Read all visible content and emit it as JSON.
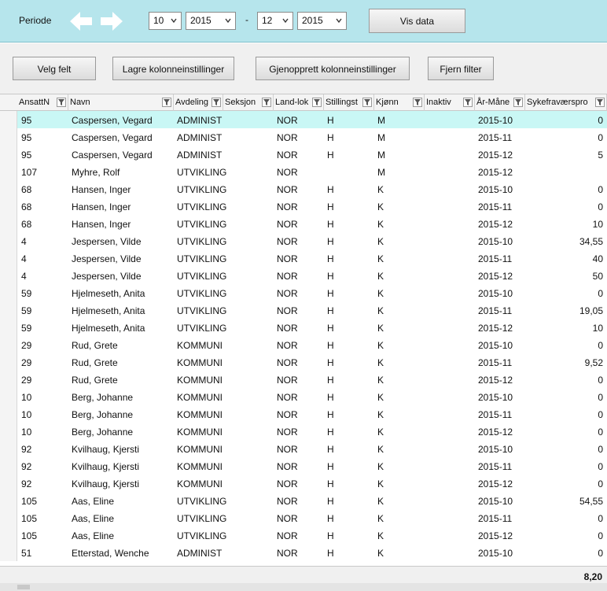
{
  "period": {
    "label": "Periode",
    "from_month": "10",
    "from_year": "2015",
    "separator": "-",
    "to_month": "12",
    "to_year": "2015",
    "show_button": "Vis data"
  },
  "toolbar": {
    "select_fields": "Velg felt",
    "save_columns": "Lagre kolonneinstillinger",
    "restore_columns": "Gjenopprett kolonneinstillinger",
    "remove_filter": "Fjern filter"
  },
  "columns": [
    {
      "label": "AnsattN"
    },
    {
      "label": "Navn"
    },
    {
      "label": "Avdeling"
    },
    {
      "label": "Seksjon"
    },
    {
      "label": "Land-lok"
    },
    {
      "label": "Stillingst"
    },
    {
      "label": "Kjønn"
    },
    {
      "label": "Inaktiv"
    },
    {
      "label": "År-Måne"
    },
    {
      "label": "Sykefraværspro"
    }
  ],
  "rows": [
    {
      "id": "95",
      "name": "Caspersen, Vegard",
      "dept": "ADMINIST",
      "country": "NOR",
      "pos": "H",
      "gender": "M",
      "period": "2015-10",
      "pct": "0"
    },
    {
      "id": "95",
      "name": "Caspersen, Vegard",
      "dept": "ADMINIST",
      "country": "NOR",
      "pos": "H",
      "gender": "M",
      "period": "2015-11",
      "pct": "0"
    },
    {
      "id": "95",
      "name": "Caspersen, Vegard",
      "dept": "ADMINIST",
      "country": "NOR",
      "pos": "H",
      "gender": "M",
      "period": "2015-12",
      "pct": "5"
    },
    {
      "id": "107",
      "name": "Myhre, Rolf",
      "dept": "UTVIKLING",
      "country": "NOR",
      "pos": "",
      "gender": "M",
      "period": "2015-12",
      "pct": ""
    },
    {
      "id": "68",
      "name": "Hansen, Inger",
      "dept": "UTVIKLING",
      "country": "NOR",
      "pos": "H",
      "gender": "K",
      "period": "2015-10",
      "pct": "0"
    },
    {
      "id": "68",
      "name": "Hansen, Inger",
      "dept": "UTVIKLING",
      "country": "NOR",
      "pos": "H",
      "gender": "K",
      "period": "2015-11",
      "pct": "0"
    },
    {
      "id": "68",
      "name": "Hansen, Inger",
      "dept": "UTVIKLING",
      "country": "NOR",
      "pos": "H",
      "gender": "K",
      "period": "2015-12",
      "pct": "10"
    },
    {
      "id": "4",
      "name": "Jespersen, Vilde",
      "dept": "UTVIKLING",
      "country": "NOR",
      "pos": "H",
      "gender": "K",
      "period": "2015-10",
      "pct": "34,55"
    },
    {
      "id": "4",
      "name": "Jespersen, Vilde",
      "dept": "UTVIKLING",
      "country": "NOR",
      "pos": "H",
      "gender": "K",
      "period": "2015-11",
      "pct": "40"
    },
    {
      "id": "4",
      "name": "Jespersen, Vilde",
      "dept": "UTVIKLING",
      "country": "NOR",
      "pos": "H",
      "gender": "K",
      "period": "2015-12",
      "pct": "50"
    },
    {
      "id": "59",
      "name": "Hjelmeseth, Anita",
      "dept": "UTVIKLING",
      "country": "NOR",
      "pos": "H",
      "gender": "K",
      "period": "2015-10",
      "pct": "0"
    },
    {
      "id": "59",
      "name": "Hjelmeseth, Anita",
      "dept": "UTVIKLING",
      "country": "NOR",
      "pos": "H",
      "gender": "K",
      "period": "2015-11",
      "pct": "19,05"
    },
    {
      "id": "59",
      "name": "Hjelmeseth, Anita",
      "dept": "UTVIKLING",
      "country": "NOR",
      "pos": "H",
      "gender": "K",
      "period": "2015-12",
      "pct": "10"
    },
    {
      "id": "29",
      "name": "Rud, Grete",
      "dept": "KOMMUNI",
      "country": "NOR",
      "pos": "H",
      "gender": "K",
      "period": "2015-10",
      "pct": "0"
    },
    {
      "id": "29",
      "name": "Rud, Grete",
      "dept": "KOMMUNI",
      "country": "NOR",
      "pos": "H",
      "gender": "K",
      "period": "2015-11",
      "pct": "9,52"
    },
    {
      "id": "29",
      "name": "Rud, Grete",
      "dept": "KOMMUNI",
      "country": "NOR",
      "pos": "H",
      "gender": "K",
      "period": "2015-12",
      "pct": "0"
    },
    {
      "id": "10",
      "name": "Berg, Johanne",
      "dept": "KOMMUNI",
      "country": "NOR",
      "pos": "H",
      "gender": "K",
      "period": "2015-10",
      "pct": "0"
    },
    {
      "id": "10",
      "name": "Berg, Johanne",
      "dept": "KOMMUNI",
      "country": "NOR",
      "pos": "H",
      "gender": "K",
      "period": "2015-11",
      "pct": "0"
    },
    {
      "id": "10",
      "name": "Berg, Johanne",
      "dept": "KOMMUNI",
      "country": "NOR",
      "pos": "H",
      "gender": "K",
      "period": "2015-12",
      "pct": "0"
    },
    {
      "id": "92",
      "name": "Kvilhaug, Kjersti",
      "dept": "KOMMUNI",
      "country": "NOR",
      "pos": "H",
      "gender": "K",
      "period": "2015-10",
      "pct": "0"
    },
    {
      "id": "92",
      "name": "Kvilhaug, Kjersti",
      "dept": "KOMMUNI",
      "country": "NOR",
      "pos": "H",
      "gender": "K",
      "period": "2015-11",
      "pct": "0"
    },
    {
      "id": "92",
      "name": "Kvilhaug, Kjersti",
      "dept": "KOMMUNI",
      "country": "NOR",
      "pos": "H",
      "gender": "K",
      "period": "2015-12",
      "pct": "0"
    },
    {
      "id": "105",
      "name": "Aas, Eline",
      "dept": "UTVIKLING",
      "country": "NOR",
      "pos": "H",
      "gender": "K",
      "period": "2015-10",
      "pct": "54,55"
    },
    {
      "id": "105",
      "name": "Aas, Eline",
      "dept": "UTVIKLING",
      "country": "NOR",
      "pos": "H",
      "gender": "K",
      "period": "2015-11",
      "pct": "0"
    },
    {
      "id": "105",
      "name": "Aas, Eline",
      "dept": "UTVIKLING",
      "country": "NOR",
      "pos": "H",
      "gender": "K",
      "period": "2015-12",
      "pct": "0"
    },
    {
      "id": "51",
      "name": "Etterstad, Wenche",
      "dept": "ADMINIST",
      "country": "NOR",
      "pos": "H",
      "gender": "K",
      "period": "2015-10",
      "pct": "0"
    }
  ],
  "selected_row": 0,
  "total": "8,20",
  "colors": {
    "header_bar": "#b6e5ec",
    "selected_row": "#c9f7f5"
  }
}
